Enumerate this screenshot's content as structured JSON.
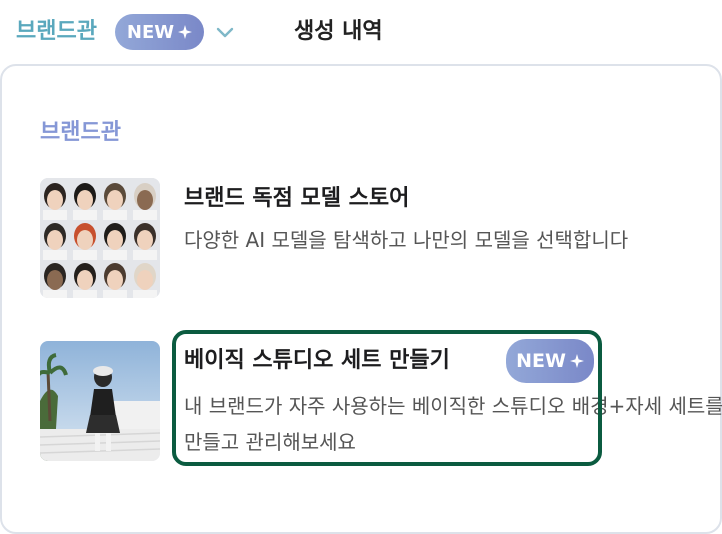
{
  "topbar": {
    "brand_label": "브랜드관",
    "new_badge": "NEW",
    "history_label": "생성 내역"
  },
  "menu": {
    "section_title": "브랜드관",
    "items": [
      {
        "title": "브랜드 독점 모델 스토어",
        "description": "다양한 AI 모델을 탐색하고 나만의 모델을 선택합니다"
      },
      {
        "title": "베이직 스튜디오 세트 만들기",
        "badge": "NEW",
        "description": "내 브랜드가 자주 사용하는 베이직한 스튜디오 배경+자세 세트를 만들고 관리해보세요"
      }
    ]
  },
  "colors": {
    "brand_teal": "#5aa8bd",
    "badge_gradient_start": "#93a8d8",
    "badge_gradient_end": "#7a88c8",
    "section_title": "#8597d6",
    "highlight_border": "#0b5b40"
  }
}
